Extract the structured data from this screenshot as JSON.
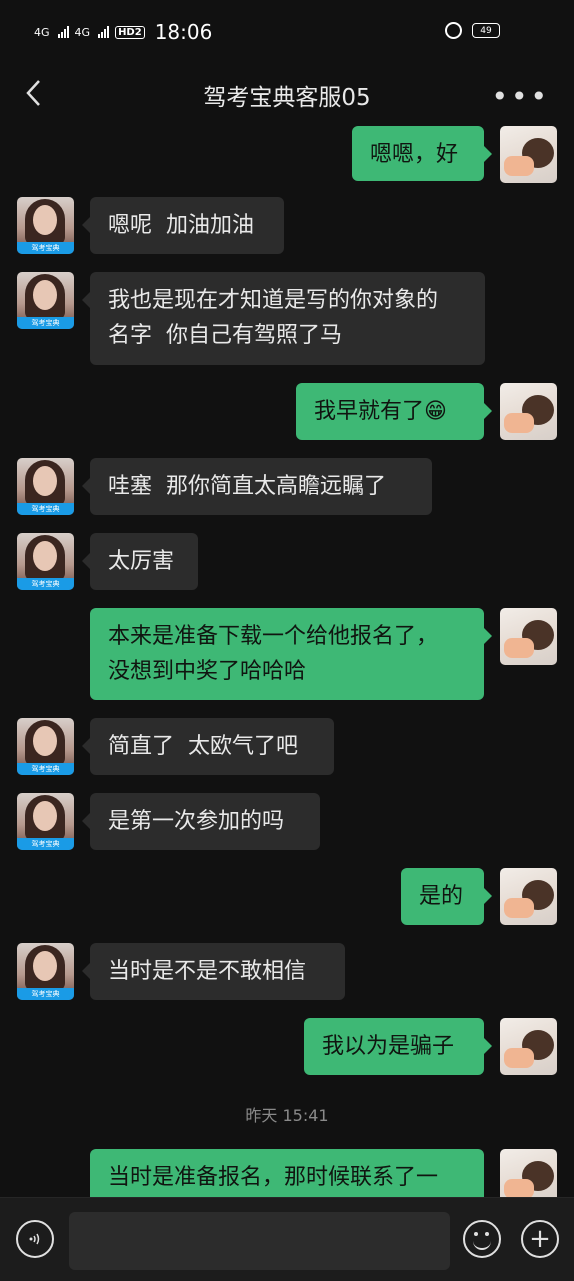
{
  "status": {
    "net1": "4G",
    "net2": "4G",
    "hd": "HD2",
    "time": "18:06",
    "battery": "49"
  },
  "header": {
    "title": "驾考宝典客服05",
    "back": "‹",
    "more": "•••"
  },
  "messages": [
    {
      "side": "right",
      "text": "嗯嗯，好"
    },
    {
      "side": "left",
      "text": "嗯呢  加油加油"
    },
    {
      "side": "left",
      "text": "我也是现在才知道是写的你对象的\n名字  你自己有驾照了马"
    },
    {
      "side": "right",
      "text": "我早就有了😁"
    },
    {
      "side": "left",
      "text": "哇塞  那你简直太高瞻远瞩了"
    },
    {
      "side": "left",
      "text": "太厉害"
    },
    {
      "side": "right",
      "text": "本来是准备下载一个给他报名了，\n没想到中奖了哈哈哈"
    },
    {
      "side": "left",
      "text": "简直了  太欧气了吧"
    },
    {
      "side": "left",
      "text": "是第一次参加的吗"
    },
    {
      "side": "right",
      "text": "是的"
    },
    {
      "side": "left",
      "text": "当时是不是不敢相信"
    },
    {
      "side": "right",
      "text": "我以为是骗子"
    },
    {
      "side": "right",
      "text": "当时是准备报名，那时候联系了一"
    }
  ],
  "timestamp": "昨天 15:41",
  "avatar_label": "驾考宝典",
  "input": {
    "placeholder": ""
  },
  "colors": {
    "background": "#111111",
    "bubble_right": "#3eb875",
    "bubble_left": "#2c2c2c"
  }
}
